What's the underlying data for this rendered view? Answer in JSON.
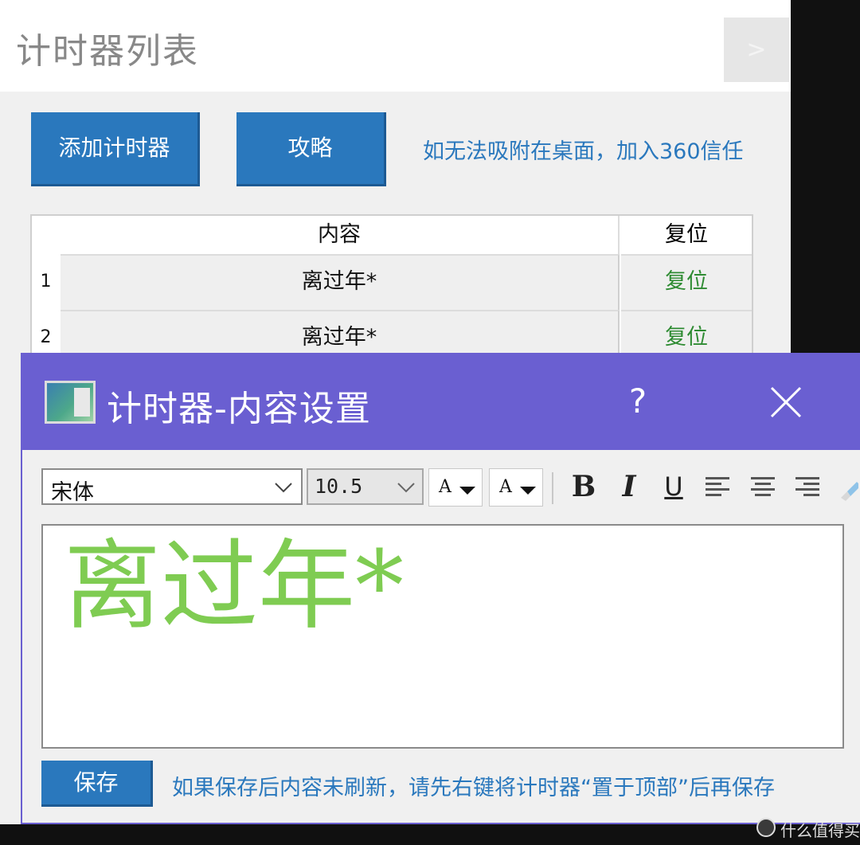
{
  "list_window": {
    "title": "计时器列表",
    "close_label": ">",
    "add_button_label": "添加计时器",
    "guide_button_label": "攻略",
    "trust_hint": "如无法吸附在桌面，加入360信任",
    "table": {
      "columns": [
        "内容",
        "复位"
      ],
      "rows": [
        {
          "index": "1",
          "content": "离过年*",
          "reset": "复位"
        },
        {
          "index": "2",
          "content": "离过年*",
          "reset": "复位"
        }
      ]
    }
  },
  "dialog": {
    "title": "计时器-内容设置",
    "help_label": "?",
    "toolbar": {
      "font_value": "宋体",
      "size_value": "10.5",
      "text_color_glyph": "A",
      "bg_color_glyph": "A",
      "bold_label": "B",
      "italic_label": "I",
      "underline_label": "U"
    },
    "editor": {
      "text": "离过年*",
      "text_color": "#7fcc52"
    },
    "save_button_label": "保存",
    "save_hint": "如果保存后内容未刷新，请先右键将计时器“置于顶部”后再保存"
  },
  "watermark": {
    "text": "什么值得买"
  },
  "colors": {
    "dialog_titlebar": "#6a5fd1",
    "button_blue": "#2a78bd",
    "reset_green": "#2e8b32",
    "link_blue": "#2a78bd"
  }
}
